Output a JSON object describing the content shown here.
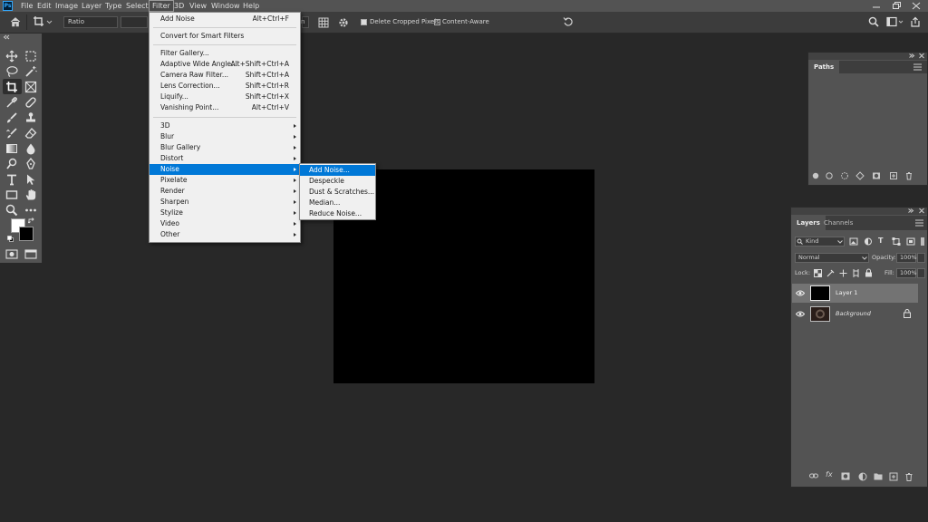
{
  "app": {
    "logo_text": "Ps"
  },
  "menubar": {
    "items": [
      "File",
      "Edit",
      "Image",
      "Layer",
      "Type",
      "Select",
      "Filter",
      "3D",
      "View",
      "Window",
      "Help"
    ]
  },
  "options": {
    "ratio_label": "Ratio",
    "delete_cropped_label": "Delete Cropped Pixels",
    "delete_cropped_checked": true,
    "content_aware_label": "Content-Aware",
    "content_aware_checked": false
  },
  "filter_menu": {
    "last_filter": {
      "label": "Add Noise",
      "shortcut": "Alt+Ctrl+F"
    },
    "convert_smart": "Convert for Smart Filters",
    "group1": [
      {
        "label": "Filter Gallery...",
        "shortcut": ""
      },
      {
        "label": "Adaptive Wide Angle...",
        "shortcut": "Alt+Shift+Ctrl+A"
      },
      {
        "label": "Camera Raw Filter...",
        "shortcut": "Shift+Ctrl+A"
      },
      {
        "label": "Lens Correction...",
        "shortcut": "Shift+Ctrl+R"
      },
      {
        "label": "Liquify...",
        "shortcut": "Shift+Ctrl+X"
      },
      {
        "label": "Vanishing Point...",
        "shortcut": "Alt+Ctrl+V"
      }
    ],
    "group2": [
      "3D",
      "Blur",
      "Blur Gallery",
      "Distort",
      "Noise",
      "Pixelate",
      "Render",
      "Sharpen",
      "Stylize",
      "Video",
      "Other"
    ],
    "highlighted": "Noise"
  },
  "noise_submenu": {
    "items": [
      "Add Noise...",
      "Despeckle",
      "Dust & Scratches...",
      "Median...",
      "Reduce Noise..."
    ],
    "highlighted": "Add Noise..."
  },
  "paths_panel": {
    "tab_label": "Paths"
  },
  "layers_panel": {
    "tabs": [
      "Layers",
      "Channels"
    ],
    "kind_label": "Kind",
    "blend_mode": "Normal",
    "opacity_label": "Opacity:",
    "opacity_value": "100%",
    "lock_label": "Lock:",
    "fill_label": "Fill:",
    "fill_value": "100%",
    "layers": [
      {
        "name": "Layer 1",
        "selected": true
      },
      {
        "name": "Background",
        "selected": false,
        "locked": true
      }
    ]
  },
  "colors": {
    "accent": "#0078d7",
    "menubar": "#535353",
    "workspace": "#282828",
    "canvas": "#000000",
    "menu_bg": "#f0f0f0"
  }
}
